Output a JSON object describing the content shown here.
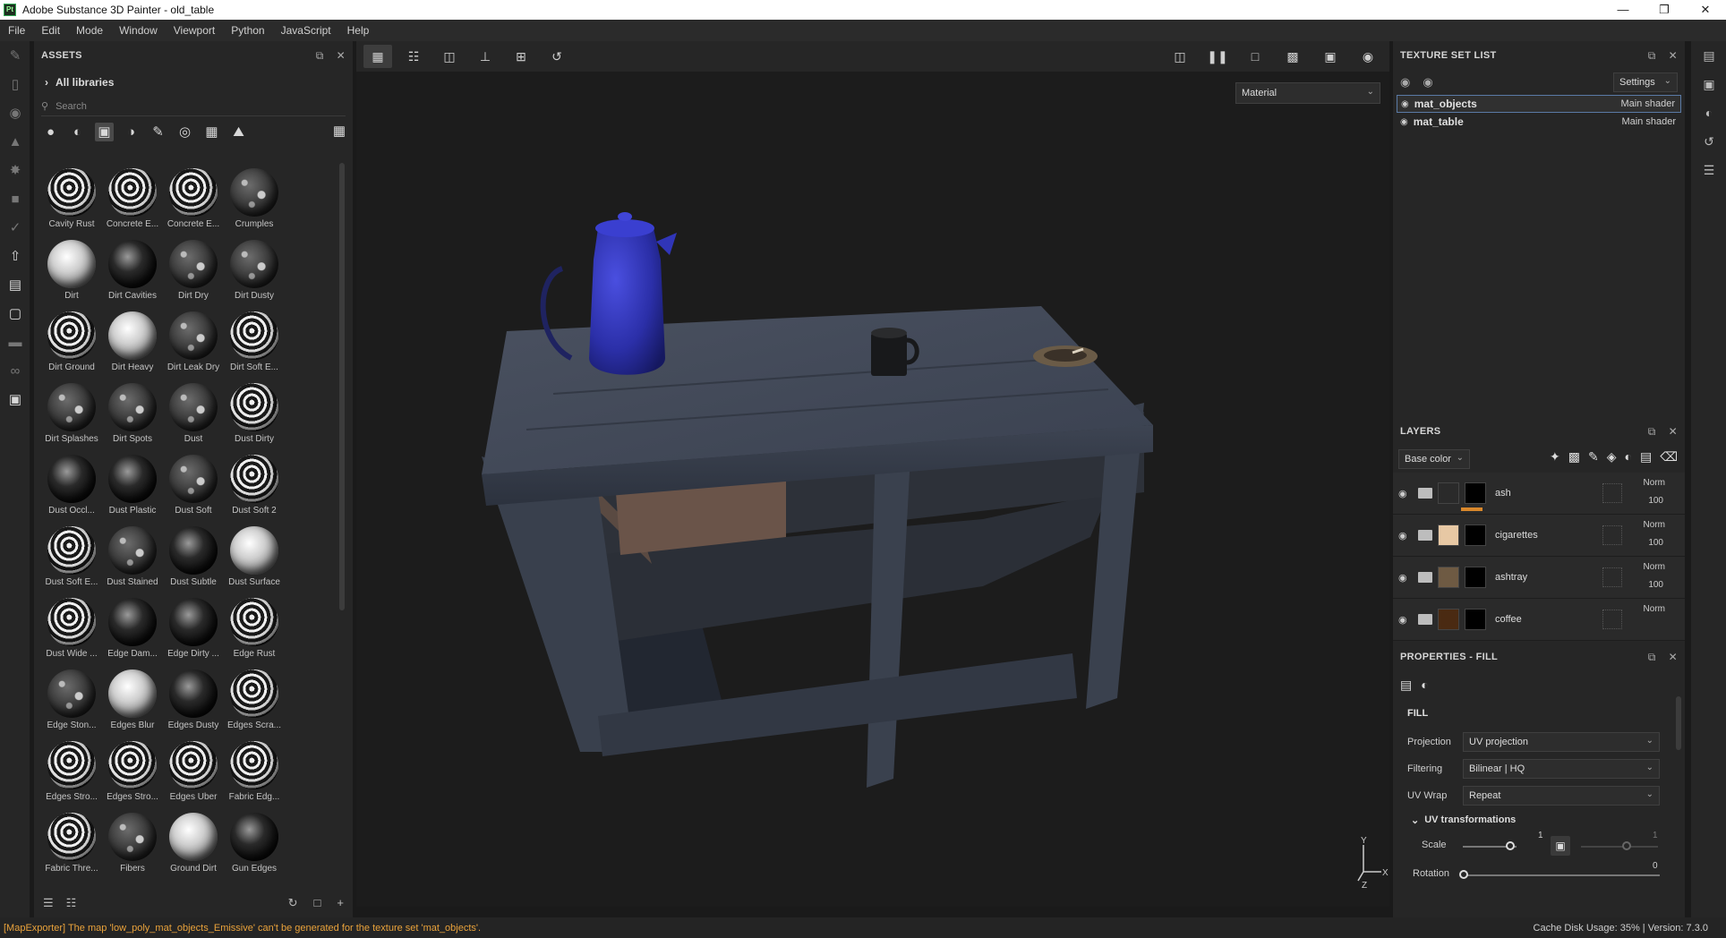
{
  "window": {
    "title": "Adobe Substance 3D Painter - old_table",
    "app_icon_text": "Pt"
  },
  "menu": [
    "File",
    "Edit",
    "Mode",
    "Window",
    "Viewport",
    "Python",
    "JavaScript",
    "Help"
  ],
  "assets": {
    "title": "ASSETS",
    "library": "All libraries",
    "search_placeholder": "Search",
    "items": [
      {
        "label": "Cavity Rust",
        "style": "ring"
      },
      {
        "label": "Concrete E...",
        "style": "ring"
      },
      {
        "label": "Concrete E...",
        "style": "ring"
      },
      {
        "label": "Crumples",
        "style": "noise"
      },
      {
        "label": "Dirt",
        "style": "light"
      },
      {
        "label": "Dirt Cavities",
        "style": "dark"
      },
      {
        "label": "Dirt Dry",
        "style": "noise"
      },
      {
        "label": "Dirt Dusty",
        "style": "noise"
      },
      {
        "label": "Dirt Ground",
        "style": "ring"
      },
      {
        "label": "Dirt Heavy",
        "style": "light"
      },
      {
        "label": "Dirt Leak Dry",
        "style": "noise"
      },
      {
        "label": "Dirt Soft E...",
        "style": "ring"
      },
      {
        "label": "Dirt Splashes",
        "style": "noise"
      },
      {
        "label": "Dirt Spots",
        "style": "noise"
      },
      {
        "label": "Dust",
        "style": "noise"
      },
      {
        "label": "Dust Dirty",
        "style": "ring"
      },
      {
        "label": "Dust Occl...",
        "style": "dark"
      },
      {
        "label": "Dust Plastic",
        "style": "dark"
      },
      {
        "label": "Dust Soft",
        "style": "noise"
      },
      {
        "label": "Dust Soft 2",
        "style": "ring"
      },
      {
        "label": "Dust Soft E...",
        "style": "ring"
      },
      {
        "label": "Dust Stained",
        "style": "noise"
      },
      {
        "label": "Dust Subtle",
        "style": "dark"
      },
      {
        "label": "Dust Surface",
        "style": "light"
      },
      {
        "label": "Dust Wide ...",
        "style": "ring"
      },
      {
        "label": "Edge Dam...",
        "style": "dark"
      },
      {
        "label": "Edge Dirty ...",
        "style": "dark"
      },
      {
        "label": "Edge Rust",
        "style": "ring"
      },
      {
        "label": "Edge Ston...",
        "style": "noise"
      },
      {
        "label": "Edges Blur",
        "style": "light"
      },
      {
        "label": "Edges Dusty",
        "style": "dark"
      },
      {
        "label": "Edges Scra...",
        "style": "ring"
      },
      {
        "label": "Edges Stro...",
        "style": "ring"
      },
      {
        "label": "Edges Stro...",
        "style": "ring"
      },
      {
        "label": "Edges Uber",
        "style": "ring"
      },
      {
        "label": "Fabric Edg...",
        "style": "ring"
      },
      {
        "label": "Fabric Thre...",
        "style": "ring"
      },
      {
        "label": "Fibers",
        "style": "noise"
      },
      {
        "label": "Ground Dirt",
        "style": "light"
      },
      {
        "label": "Gun Edges",
        "style": "dark"
      }
    ]
  },
  "viewport": {
    "material_mode": "Material"
  },
  "texture_sets": {
    "title": "TEXTURE SET LIST",
    "settings_label": "Settings",
    "items": [
      {
        "name": "mat_objects",
        "shader": "Main shader",
        "selected": true
      },
      {
        "name": "mat_table",
        "shader": "Main shader",
        "selected": false
      }
    ]
  },
  "layers": {
    "title": "LAYERS",
    "channel": "Base color",
    "items": [
      {
        "name": "ash",
        "blend": "Norm",
        "opacity": "100",
        "thumb": "#2a2a2a",
        "accent": "#d9882c"
      },
      {
        "name": "cigarettes",
        "blend": "Norm",
        "opacity": "100",
        "thumb": "#e7c8a4",
        "accent": ""
      },
      {
        "name": "ashtray",
        "blend": "Norm",
        "opacity": "100",
        "thumb": "#6e5a43",
        "accent": ""
      },
      {
        "name": "coffee",
        "blend": "Norm",
        "opacity": "",
        "thumb": "#4a2a12",
        "accent": ""
      }
    ]
  },
  "properties": {
    "title": "PROPERTIES - FILL",
    "section": "FILL",
    "projection_label": "Projection",
    "projection_value": "UV projection",
    "filtering_label": "Filtering",
    "filtering_value": "Bilinear | HQ",
    "wrap_label": "UV Wrap",
    "wrap_value": "Repeat",
    "uv_transform_label": "UV transformations",
    "scale_label": "Scale",
    "scale_value": "1",
    "scale_value_2": "1",
    "rotation_label": "Rotation",
    "rotation_value": "0"
  },
  "status": {
    "message": "[MapExporter] The map 'low_poly_mat_objects_Emissive' can't be generated for the texture set 'mat_objects'.",
    "cache": "Cache Disk Usage:   35% | Version: 7.3.0"
  },
  "colors": {
    "accent_orange": "#d9882c",
    "selection_blue": "#5a7aa5",
    "pot_blue": "#2b2fa8"
  }
}
